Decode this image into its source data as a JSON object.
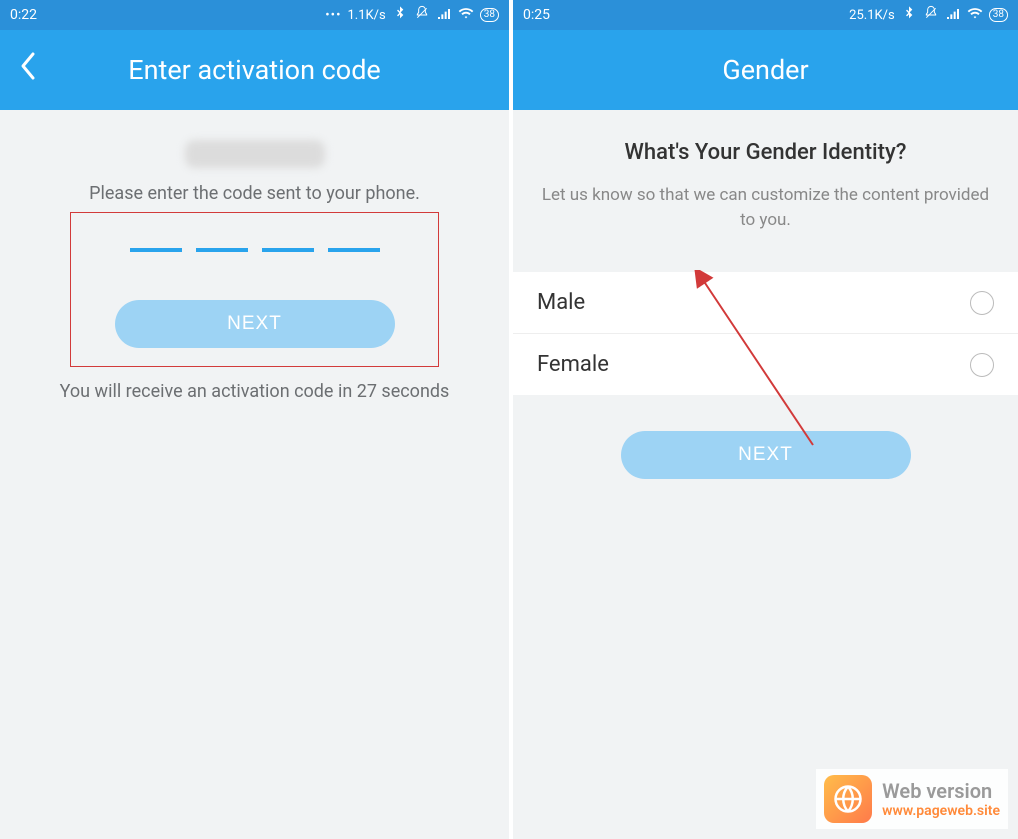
{
  "left": {
    "status": {
      "time": "0:22",
      "speed": "1.1K/s",
      "battery": "38"
    },
    "title": "Enter activation code",
    "instruction": "Please enter the code sent to your phone.",
    "next_label": "NEXT",
    "countdown": "You will receive an activation code in 27 seconds"
  },
  "right": {
    "status": {
      "time": "0:25",
      "speed": "25.1K/s",
      "battery": "38"
    },
    "title": "Gender",
    "question": "What's Your Gender Identity?",
    "subtext": "Let us know so that we can customize the content provided to you.",
    "options": [
      {
        "label": "Male"
      },
      {
        "label": "Female"
      }
    ],
    "next_label": "NEXT"
  },
  "watermark": {
    "line1": "Web version",
    "line2": "www.pageweb.site"
  }
}
